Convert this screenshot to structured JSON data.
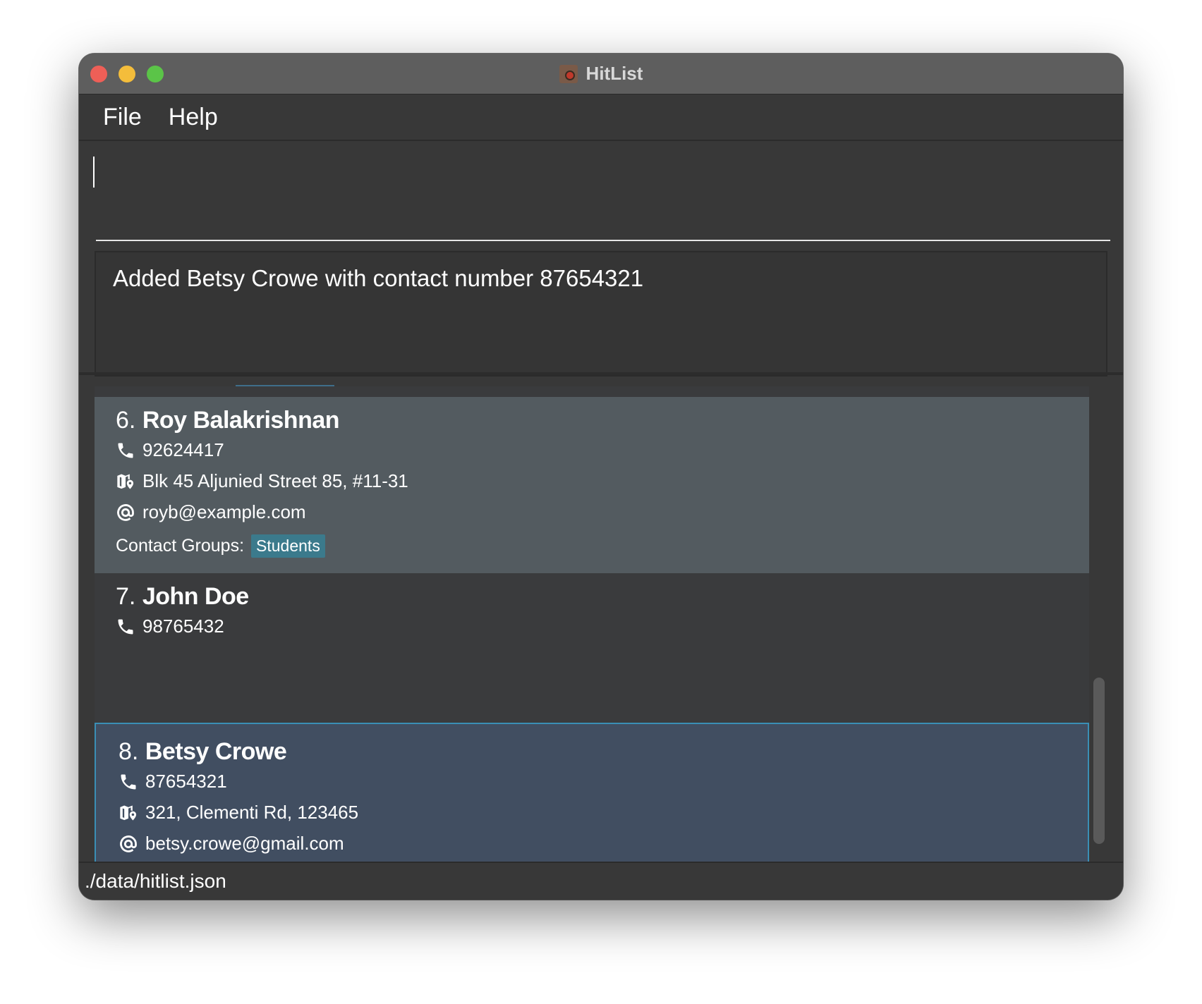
{
  "window": {
    "title": "HitList"
  },
  "menu": {
    "file": "File",
    "help": "Help"
  },
  "command": {
    "value": ""
  },
  "result": {
    "text": "Added Betsy Crowe with contact number 87654321"
  },
  "persons": [
    {
      "index": "6.",
      "name": "Roy Balakrishnan",
      "phone": "92624417",
      "address": "Blk 45 Aljunied Street 85, #11-31",
      "email": "royb@example.com",
      "groups_label": "Contact Groups:",
      "groups": [
        "Students"
      ]
    },
    {
      "index": "7.",
      "name": "John Doe",
      "phone": "98765432"
    },
    {
      "index": "8.",
      "name": "Betsy Crowe",
      "phone": "87654321",
      "address": "321, Clementi Rd, 123465",
      "email": "betsy.crowe@gmail.com",
      "selected": true
    }
  ],
  "status": {
    "path": "./data/hitlist.json"
  },
  "icons": {
    "phone": "phone-icon",
    "address": "map-pin-icon",
    "email": "at-sign-icon"
  },
  "colors": {
    "window_bg": "#383838",
    "selected_card_bg": "#414e61",
    "selected_border": "#3a8fb5",
    "hover_card_bg": "#535b60",
    "tag_bg": "#3b7a8c"
  }
}
